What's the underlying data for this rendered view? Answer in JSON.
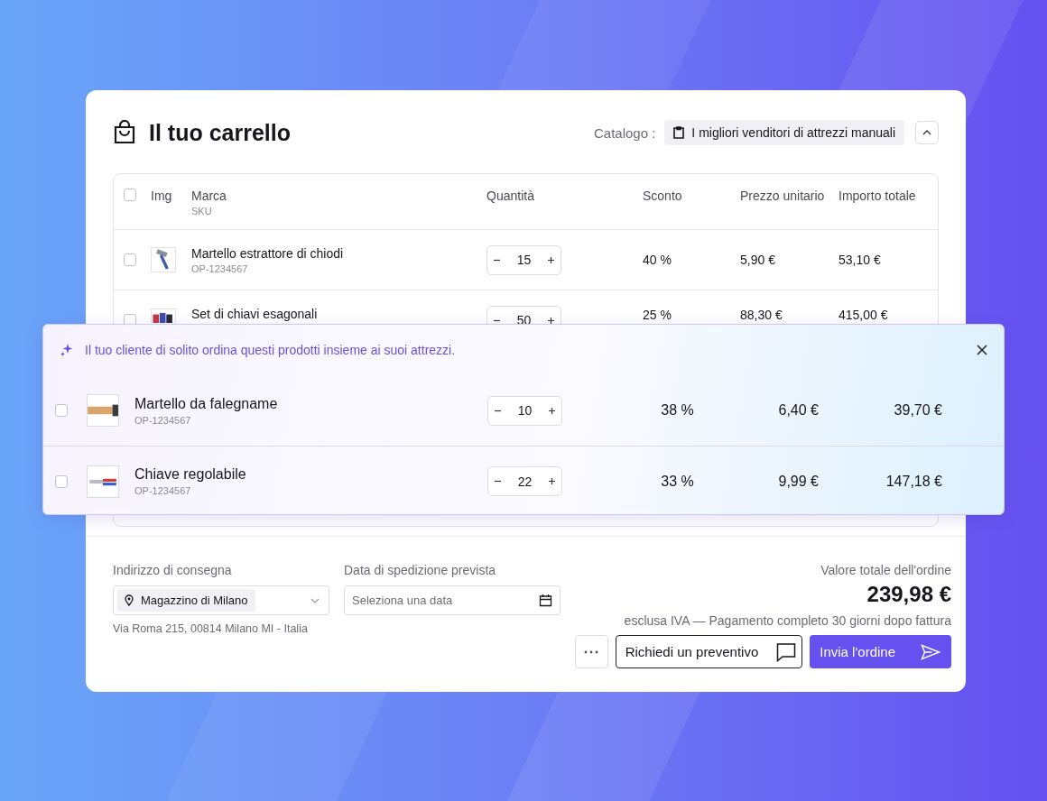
{
  "cart": {
    "title": "Il tuo carrello",
    "catalog_label": "Catalogo :",
    "catalog_value": "I migliori venditori di attrezzi manuali"
  },
  "table": {
    "select_all_checked": false,
    "columns": [
      {
        "label": "Img"
      },
      {
        "label": "Marca",
        "sub": "SKU"
      },
      {
        "label": "Quantità"
      },
      {
        "label": "Sconto"
      },
      {
        "label": "Prezzo unitario"
      },
      {
        "label": "Importo totale"
      }
    ],
    "rows": [
      {
        "checked": false,
        "name": "Martello estrattore di chiodi",
        "sku": "OP-1234567",
        "quantity": "15",
        "discount": "40 %",
        "unit_price": "5,90 €",
        "total": "53,10 €"
      },
      {
        "checked": false,
        "name": "Set di chiavi esagonali",
        "quantity": "50",
        "discount": "25 %",
        "unit_price": "88,30 €",
        "total": "415,00 €"
      }
    ]
  },
  "suggestions": {
    "message": "Il tuo cliente di solito ordina questi prodotti insieme ai suoi attrezzi.",
    "rows": [
      {
        "checked": false,
        "name": "Martello da falegname",
        "sku": "OP-1234567",
        "quantity": "10",
        "discount": "38 %",
        "unit_price": "6,40 €",
        "total": "39,70 €"
      },
      {
        "checked": false,
        "name": "Chiave regolabile",
        "sku": "OP-1234567",
        "quantity": "22",
        "discount": "33 %",
        "unit_price": "9,99 €",
        "total": "147,18 €"
      }
    ]
  },
  "footer": {
    "address_label": "Indirizzo di consegna",
    "address_value": "Magazzino di Milano",
    "address_line": "Via Roma 215, 00814 Milano MI - Italia",
    "date_label": "Data di spedizione prevista",
    "date_placeholder": "Seleziona una data",
    "total_label": "Valore totale dell'ordine",
    "total": "239,98 €",
    "note": "esclusa IVA — Pagamento completo 30 giorni dopo fattura",
    "quote_button": "Richiedi un preventivo",
    "send_button": "Invia l'ordine"
  }
}
